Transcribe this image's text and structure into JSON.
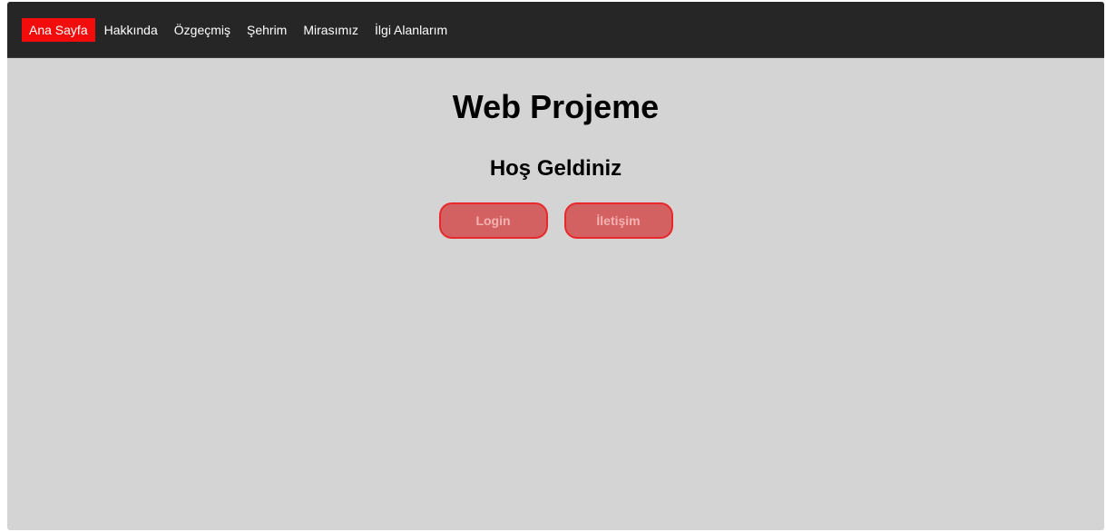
{
  "nav": {
    "items": [
      {
        "label": "Ana Sayfa",
        "active": true
      },
      {
        "label": "Hakkında",
        "active": false
      },
      {
        "label": "Özgeçmiş",
        "active": false
      },
      {
        "label": "Şehrim",
        "active": false
      },
      {
        "label": "Mirasımız",
        "active": false
      },
      {
        "label": "İlgi Alanlarım",
        "active": false
      }
    ]
  },
  "main": {
    "title": "Web Projeme",
    "subtitle": "Hoş Geldiniz",
    "login_label": "Login",
    "contact_label": "İletişim"
  },
  "colors": {
    "navbar_bg": "#262626",
    "active_nav": "#f20c0c",
    "page_bg": "#d4d4d4",
    "button_fill": "#d46161",
    "button_border": "#e8282b",
    "button_text": "#f3b1b1"
  }
}
